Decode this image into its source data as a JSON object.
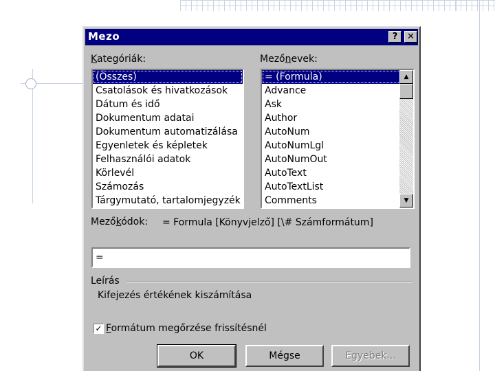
{
  "dialog": {
    "title": "Mezo",
    "help_glyph": "?",
    "close_glyph": "✕"
  },
  "categories": {
    "label_pre": "",
    "label_ul": "K",
    "label_post": "ategóriák:",
    "items": [
      "(Összes)",
      "Csatolások és hivatkozások",
      "Dátum és idő",
      "Dokumentum adatai",
      "Dokumentum automatizálása",
      "Egyenletek és képletek",
      "Felhasználói adatok",
      "Körlevél",
      "Számozás",
      "Tárgymutató, tartalomjegyzék"
    ],
    "selected": "(Összes)"
  },
  "field_names": {
    "label_pre": "Mező",
    "label_ul": "n",
    "label_post": "evek:",
    "items": [
      "= (Formula)",
      "Advance",
      "Ask",
      "Author",
      "AutoNum",
      "AutoNumLgl",
      "AutoNumOut",
      "AutoText",
      "AutoTextList",
      "Comments"
    ],
    "selected": "= (Formula)"
  },
  "field_codes": {
    "label_pre": "Mező",
    "label_ul": "k",
    "label_post": "ódok:",
    "syntax": "= Formula [Könyvjelző] [\\# Számformátum]",
    "value": "="
  },
  "description": {
    "header": "Leírás",
    "text": "Kifejezés értékének kiszámítása"
  },
  "preserve_format": {
    "checked": true,
    "check_glyph": "✓",
    "label_ul": "F",
    "label_post": "ormátum megőrzése frissítésnél"
  },
  "buttons": {
    "ok": "OK",
    "options": "Mégse",
    "more": "Egyebek..."
  }
}
